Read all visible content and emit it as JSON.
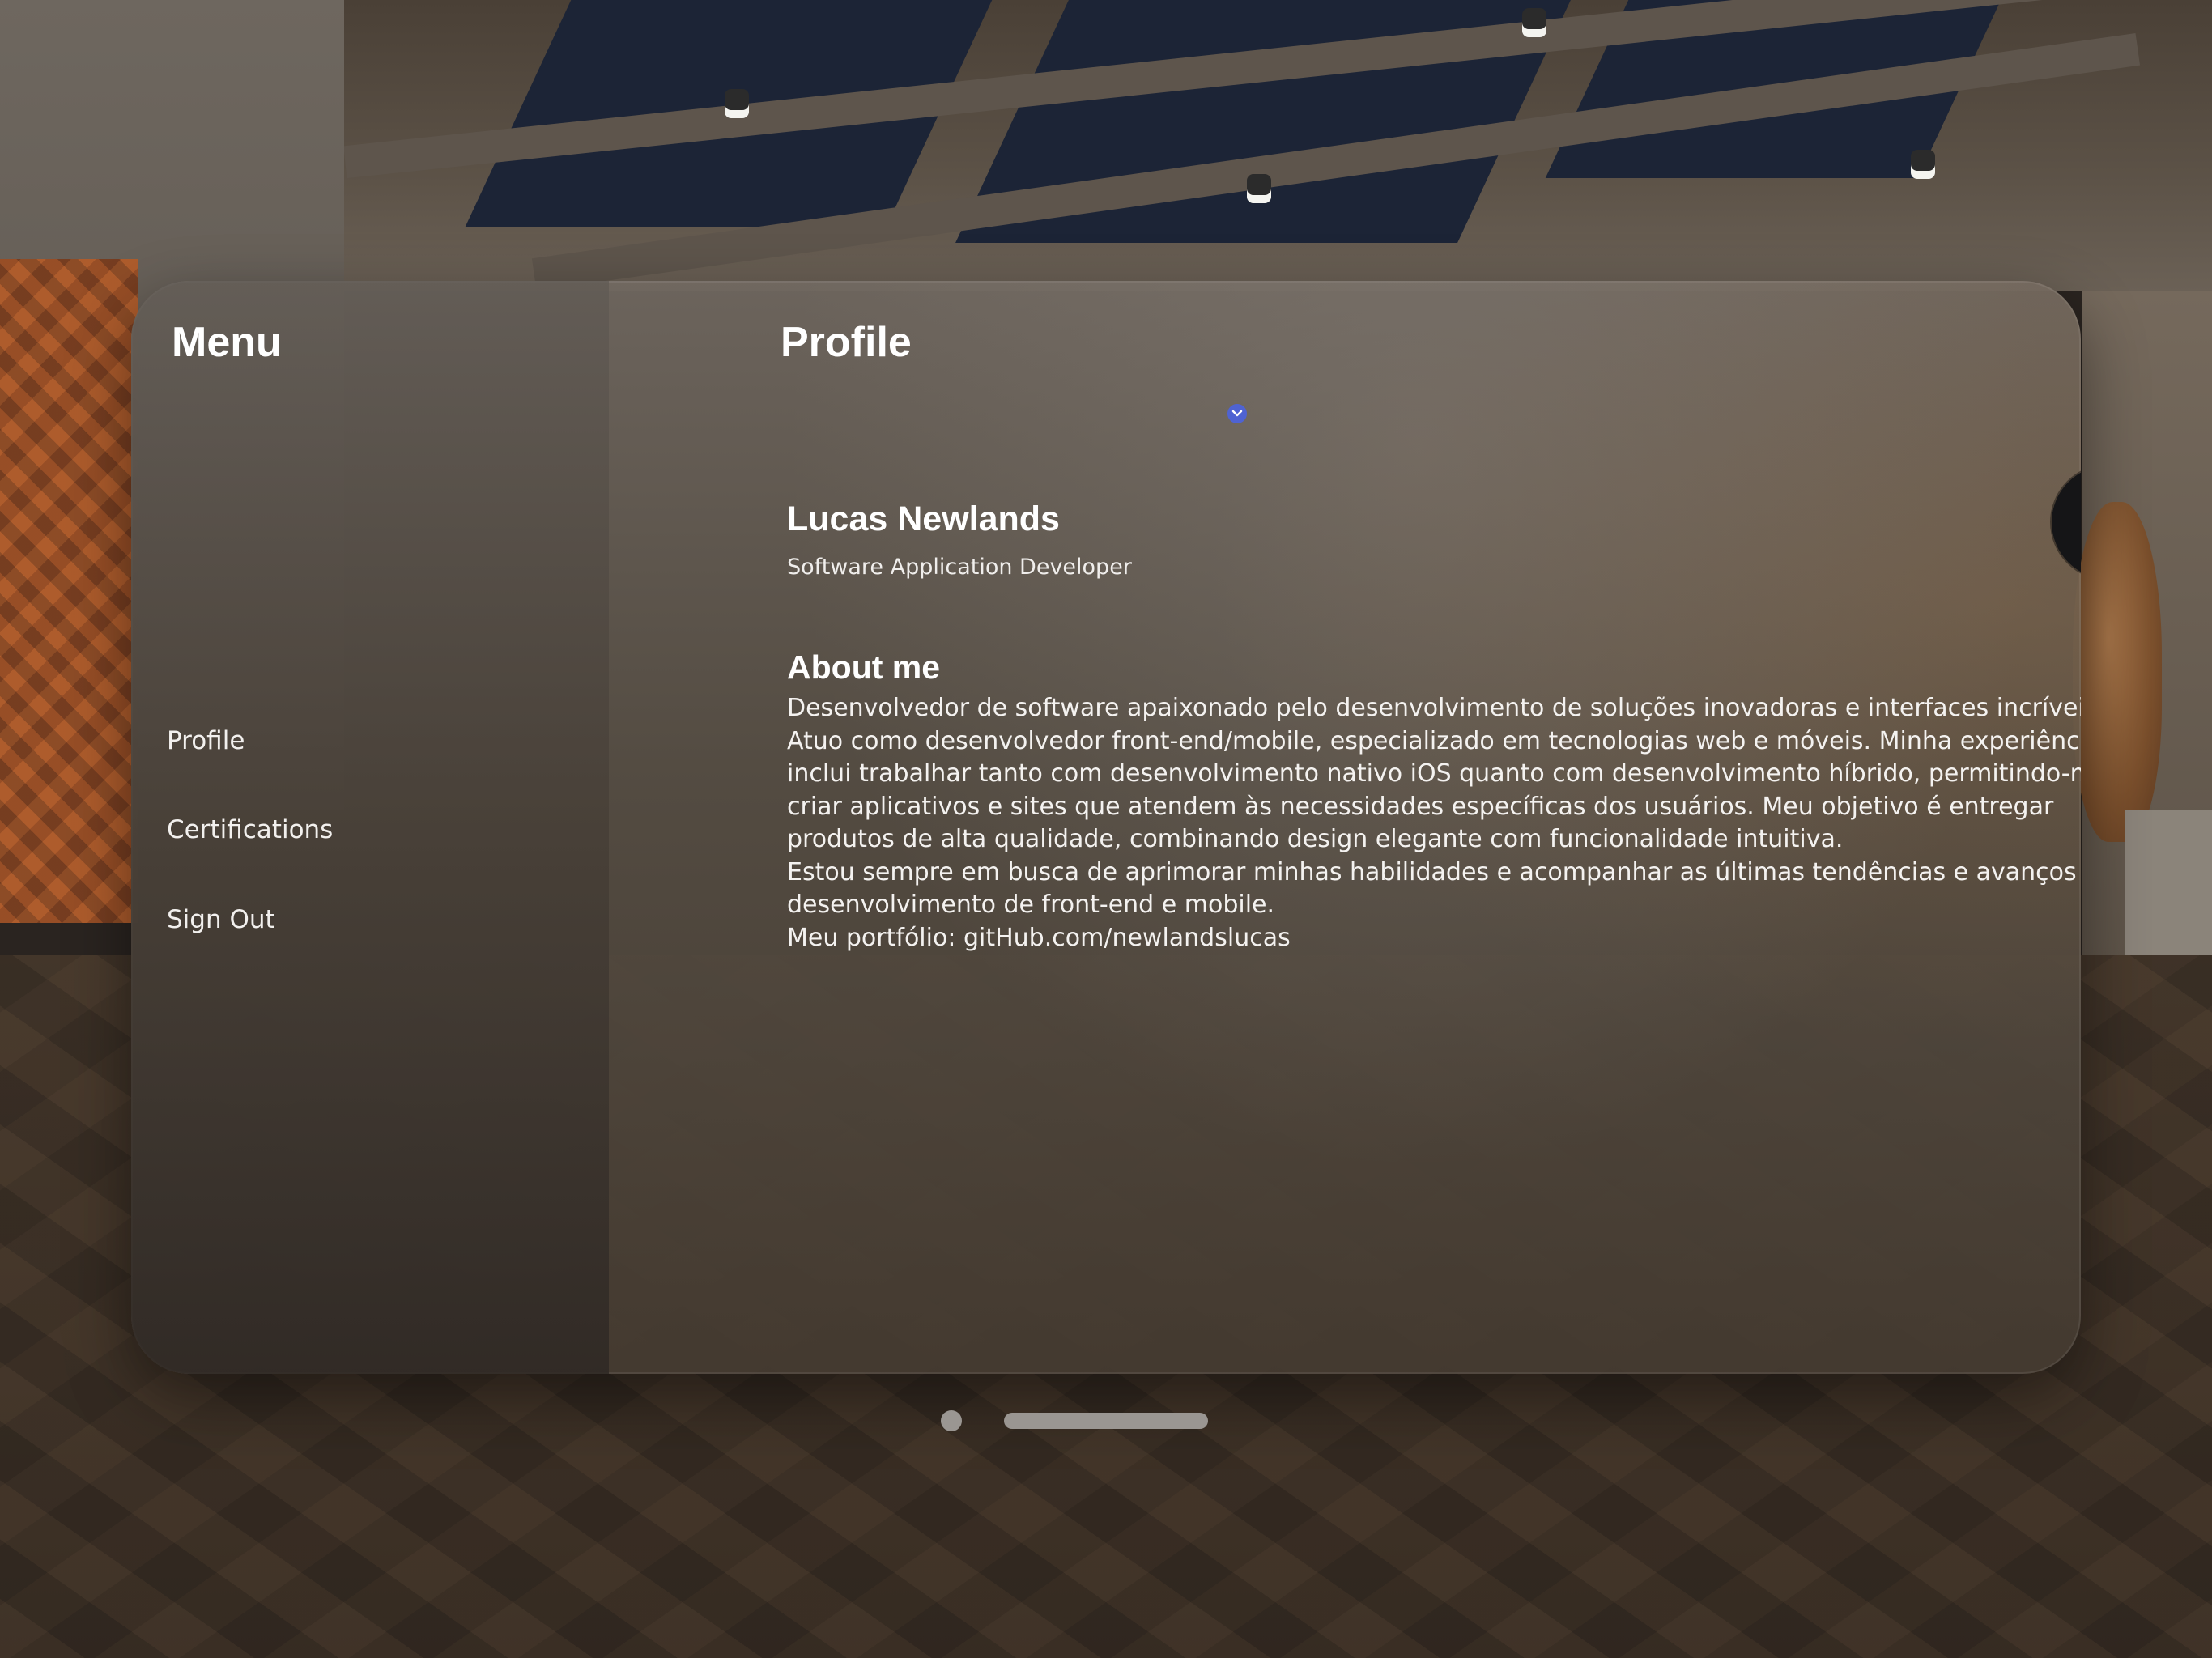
{
  "sidebar": {
    "title": "Menu",
    "items": [
      {
        "label": "Profile"
      },
      {
        "label": "Certifications"
      },
      {
        "label": "Sign Out"
      }
    ]
  },
  "content": {
    "title": "Profile",
    "profile": {
      "name": "Lucas Newlands",
      "job_title": "Software Application Developer"
    },
    "about": {
      "title": "About me",
      "lines": [
        "Desenvolvedor de software apaixonado pelo desenvolvimento de soluções inovadoras e interfaces incríveis.",
        "Atuo como desenvolvedor front-end/mobile, especializado em tecnologias web e móveis. Minha experiência",
        "inclui trabalhar tanto com desenvolvimento nativo iOS quanto com desenvolvimento híbrido, permitindo-me",
        "criar aplicativos e sites que atendem às necessidades específicas dos usuários. Meu objetivo é entregar",
        "produtos de alta qualidade, combinando design elegante com funcionalidade intuitiva.",
        "Estou sempre em busca de aprimorar minhas habilidades e acompanhar as últimas tendências e avanços no",
        "desenvolvimento de front-end e mobile.",
        "Meu portfólio: gitHub.com/newlandslucas"
      ]
    }
  },
  "icons": {
    "scroll_indicator": "chevron-down-icon",
    "avatar": "profile-photo"
  },
  "colors": {
    "text_primary": "#ffffff",
    "accent_badge": "#4f63d2",
    "window_control": "#9a9692"
  }
}
